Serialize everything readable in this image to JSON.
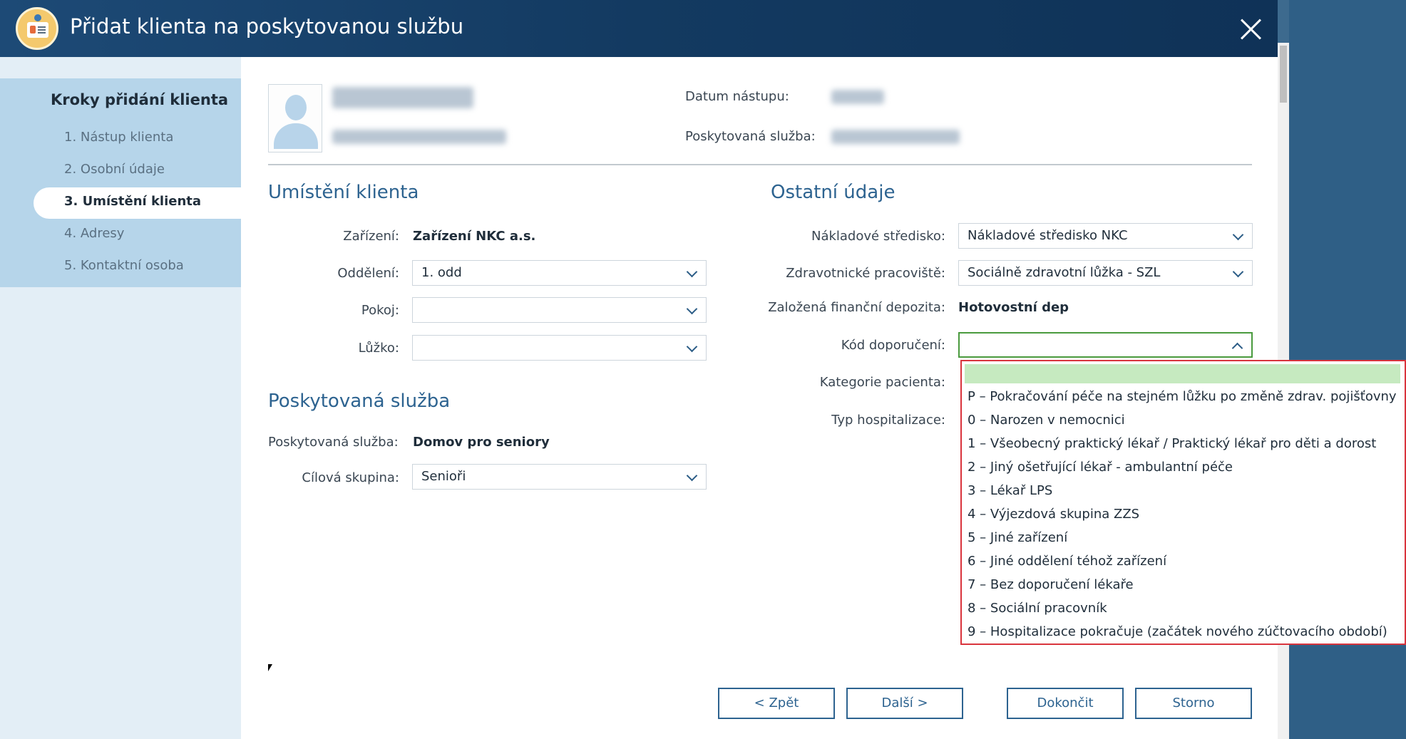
{
  "dialog": {
    "title": "Přidat klienta na poskytovanou službu"
  },
  "sidebar": {
    "title": "Kroky přidání klienta",
    "steps": [
      {
        "label": "1. Nástup klienta"
      },
      {
        "label": "2. Osobní údaje"
      },
      {
        "label": "3. Umístění klienta"
      },
      {
        "label": "4. Adresy"
      },
      {
        "label": "5. Kontaktní osoba"
      }
    ],
    "active_step": 3
  },
  "client_header": {
    "entry_date_label": "Datum nástupu:",
    "service_label": "Poskytovaná služba:"
  },
  "placement": {
    "title": "Umístění klienta",
    "facility_label": "Zařízení:",
    "facility_value": "Zařízení NKC a.s.",
    "department_label": "Oddělení:",
    "department_value": "1. odd",
    "room_label": "Pokoj:",
    "room_value": "",
    "bed_label": "Lůžko:",
    "bed_value": ""
  },
  "provided_service": {
    "title": "Poskytovaná služba",
    "service_label": "Poskytovaná služba:",
    "service_value": "Domov pro seniory",
    "target_group_label": "Cílová skupina:",
    "target_group_value": "Senioři"
  },
  "other": {
    "title": "Ostatní údaje",
    "cost_center_label": "Nákladové středisko:",
    "cost_center_value": "Nákladové středisko NKC",
    "workplace_label": "Zdravotnické pracoviště:",
    "workplace_value": "Sociálně zdravotní lůžka - SZL",
    "deposit_label": "Založená finanční depozita:",
    "deposit_value": "Hotovostní dep",
    "referral_label": "Kód doporučení:",
    "referral_value": "",
    "patient_category_label": "Kategorie pacienta:",
    "hospitalization_type_label": "Typ hospitalizace:"
  },
  "referral_options": [
    "P – Pokračování péče na stejném lůžku po změně zdrav. pojišťovny",
    "0 – Narozen v nemocnici",
    "1 – Všeobecný praktický lékař / Praktický lékař pro děti a dorost",
    "2 – Jiný ošetřující lékař - ambulantní péče",
    "3 – Lékař LPS",
    "4 – Výjezdová skupina ZZS",
    "5 – Jiné zařízení",
    "6 – Jiné oddělení téhož zařízení",
    "7 – Bez doporučení lékaře",
    "8 – Sociální pracovník",
    "9 – Hospitalizace pokračuje (začátek nového zúčtovacího období)"
  ],
  "buttons": {
    "back": "< Zpět",
    "next": "Další >",
    "finish": "Dokončit",
    "cancel": "Storno"
  },
  "colors": {
    "titlebar": "#133a61",
    "accent": "#2d6390",
    "dropdown_border": "#d9343d",
    "selected_blank": "#c6eac0",
    "open_select_border": "#4a9a3e"
  }
}
